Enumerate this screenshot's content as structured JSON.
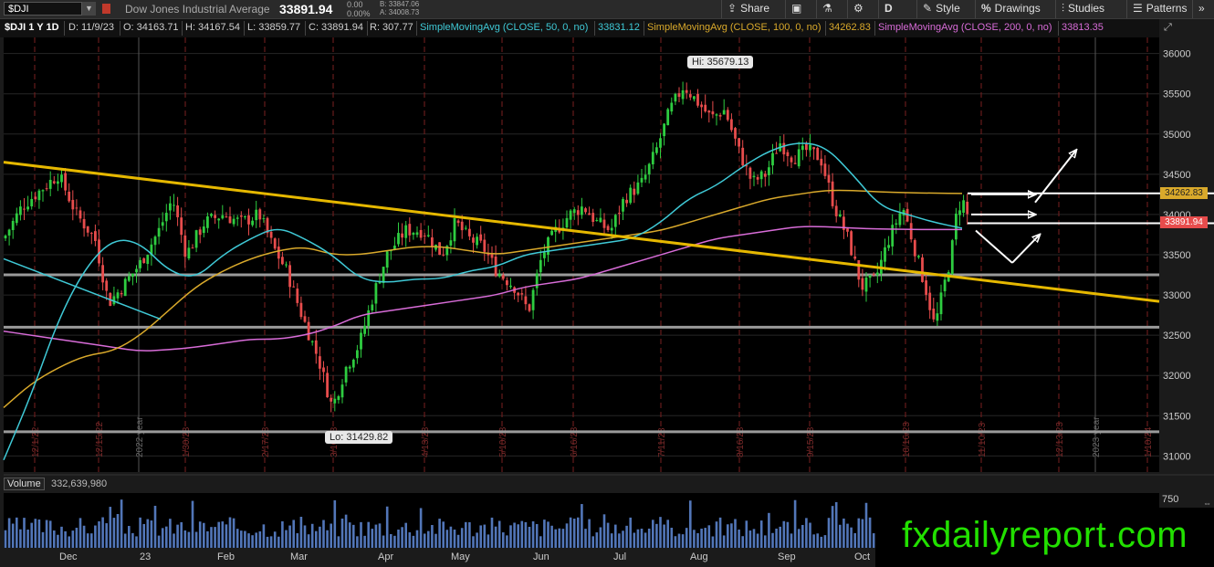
{
  "toolbar": {
    "symbol": "$DJI",
    "description": "Dow Jones Industrial Average",
    "last": "33891.94",
    "change": "0.00",
    "change_pct": "0.00%",
    "bid": "B: 33847.06",
    "ask": "A: 34008.73",
    "share_label": "Share",
    "period_label": "D",
    "style_label": "Style",
    "drawings_label": "Drawings",
    "studies_label": "Studies",
    "patterns_label": "Patterns"
  },
  "infobar": {
    "symbol_period": "$DJI 1 Y 1D",
    "date": "D: 11/9/23",
    "open": "O: 34163.71",
    "high": "H: 34167.54",
    "low": "L: 33859.77",
    "close": "C: 33891.94",
    "range": "R: 307.77",
    "sma50_label": "SimpleMovingAvg (CLOSE, 50, 0, no)",
    "sma50_value": "33831.12",
    "sma100_label": "SimpleMovingAvg (CLOSE, 100, 0, no)",
    "sma100_value": "34262.83",
    "sma200_label": "SimpleMovingAvg (CLOSE, 200, 0, no)",
    "sma200_value": "33813.35"
  },
  "colors": {
    "sma50": "#3fc9d6",
    "sma100": "#d9a92b",
    "sma200": "#d86cd8",
    "up": "#2ecc40",
    "down": "#e74c4c",
    "trendline": "#e6b800",
    "support": "#9a9a9a",
    "arrows": "#ffffff",
    "watermark": "#22e000"
  },
  "volume": {
    "label": "Volume",
    "value": "332,639,980",
    "axis_tick": "750"
  },
  "watermark": "fxdailyreport.com",
  "chart_data": {
    "type": "candlestick",
    "ylim": [
      30800,
      36200
    ],
    "yticks": [
      31000,
      31500,
      32000,
      32500,
      33000,
      33500,
      34000,
      34500,
      35000,
      35500,
      36000
    ],
    "month_labels": [
      "Dec",
      "23",
      "Feb",
      "Mar",
      "Apr",
      "May",
      "Jun",
      "Jul",
      "Aug",
      "Sep",
      "Oct"
    ],
    "date_labels": [
      "12/1/22",
      "12/15/22",
      "2022 year",
      "1/30/23",
      "2/17/23",
      "3/10/23",
      "4/13/23",
      "5/10/23",
      "6/16/23",
      "7/11/23",
      "8/16/23",
      "9/15/23",
      "10/16/23",
      "11/10/23",
      "12/13/23",
      "2023 year",
      "1/10/24"
    ],
    "high_callout": "Hi: 35679.13",
    "low_callout": "Lo: 31429.82",
    "price_marker_100": "34262.83",
    "price_marker_last": "33891.94",
    "support_levels": [
      33250,
      32600,
      31300
    ],
    "trendline": {
      "start": [
        "2022-11-10",
        34650
      ],
      "end": [
        "2024-01-12",
        32920
      ]
    },
    "sma_points": {
      "sma50": [
        [
          0,
          30950
        ],
        [
          30,
          31750
        ],
        [
          60,
          32700
        ],
        [
          90,
          33350
        ],
        [
          120,
          33700
        ],
        [
          150,
          33650
        ],
        [
          180,
          33300
        ],
        [
          210,
          33200
        ],
        [
          240,
          33500
        ],
        [
          270,
          33700
        ],
        [
          300,
          33850
        ],
        [
          330,
          33700
        ],
        [
          360,
          33500
        ],
        [
          390,
          33200
        ],
        [
          420,
          33150
        ],
        [
          450,
          33200
        ],
        [
          480,
          33200
        ],
        [
          510,
          33300
        ],
        [
          540,
          33350
        ],
        [
          570,
          33500
        ],
        [
          600,
          33550
        ],
        [
          630,
          33600
        ],
        [
          660,
          33650
        ],
        [
          690,
          33700
        ],
        [
          720,
          33900
        ],
        [
          750,
          34200
        ],
        [
          780,
          34350
        ],
        [
          810,
          34600
        ],
        [
          840,
          34800
        ],
        [
          870,
          34900
        ],
        [
          900,
          34850
        ],
        [
          930,
          34500
        ],
        [
          960,
          34100
        ],
        [
          990,
          34000
        ],
        [
          1020,
          33900
        ],
        [
          1050,
          33830
        ]
      ],
      "sma100": [
        [
          0,
          31600
        ],
        [
          30,
          31900
        ],
        [
          60,
          32100
        ],
        [
          90,
          32250
        ],
        [
          120,
          32300
        ],
        [
          150,
          32500
        ],
        [
          180,
          32800
        ],
        [
          210,
          33100
        ],
        [
          240,
          33300
        ],
        [
          270,
          33450
        ],
        [
          300,
          33550
        ],
        [
          330,
          33600
        ],
        [
          360,
          33500
        ],
        [
          390,
          33500
        ],
        [
          420,
          33550
        ],
        [
          450,
          33600
        ],
        [
          480,
          33600
        ],
        [
          510,
          33550
        ],
        [
          540,
          33500
        ],
        [
          570,
          33550
        ],
        [
          600,
          33600
        ],
        [
          630,
          33650
        ],
        [
          660,
          33700
        ],
        [
          690,
          33750
        ],
        [
          720,
          33800
        ],
        [
          750,
          33900
        ],
        [
          780,
          34000
        ],
        [
          810,
          34100
        ],
        [
          840,
          34200
        ],
        [
          870,
          34250
        ],
        [
          900,
          34300
        ],
        [
          930,
          34300
        ],
        [
          960,
          34280
        ],
        [
          990,
          34270
        ],
        [
          1020,
          34265
        ],
        [
          1050,
          34262
        ]
      ],
      "sma200": [
        [
          0,
          32550
        ],
        [
          30,
          32500
        ],
        [
          60,
          32450
        ],
        [
          90,
          32400
        ],
        [
          120,
          32350
        ],
        [
          150,
          32300
        ],
        [
          180,
          32320
        ],
        [
          210,
          32350
        ],
        [
          240,
          32400
        ],
        [
          270,
          32450
        ],
        [
          300,
          32450
        ],
        [
          330,
          32500
        ],
        [
          360,
          32600
        ],
        [
          390,
          32750
        ],
        [
          420,
          32800
        ],
        [
          450,
          32850
        ],
        [
          480,
          32900
        ],
        [
          510,
          32950
        ],
        [
          540,
          33000
        ],
        [
          570,
          33100
        ],
        [
          600,
          33150
        ],
        [
          630,
          33200
        ],
        [
          660,
          33300
        ],
        [
          690,
          33400
        ],
        [
          720,
          33500
        ],
        [
          750,
          33600
        ],
        [
          780,
          33700
        ],
        [
          810,
          33750
        ],
        [
          840,
          33800
        ],
        [
          870,
          33850
        ],
        [
          900,
          33850
        ],
        [
          930,
          33830
        ],
        [
          960,
          33820
        ],
        [
          990,
          33815
        ],
        [
          1020,
          33813
        ],
        [
          1050,
          33813
        ]
      ]
    },
    "close_path": [
      [
        0,
        33700
      ],
      [
        20,
        34100
      ],
      [
        40,
        34300
      ],
      [
        60,
        34500
      ],
      [
        80,
        34000
      ],
      [
        100,
        33700
      ],
      [
        115,
        32900
      ],
      [
        130,
        33100
      ],
      [
        150,
        33400
      ],
      [
        170,
        33800
      ],
      [
        185,
        34200
      ],
      [
        200,
        33500
      ],
      [
        220,
        33900
      ],
      [
        240,
        34000
      ],
      [
        260,
        33900
      ],
      [
        280,
        34000
      ],
      [
        295,
        33600
      ],
      [
        310,
        33300
      ],
      [
        325,
        32800
      ],
      [
        345,
        32200
      ],
      [
        360,
        31600
      ],
      [
        375,
        32100
      ],
      [
        390,
        32400
      ],
      [
        405,
        33000
      ],
      [
        420,
        33500
      ],
      [
        440,
        33800
      ],
      [
        460,
        33800
      ],
      [
        480,
        33500
      ],
      [
        495,
        33900
      ],
      [
        510,
        33700
      ],
      [
        525,
        33600
      ],
      [
        540,
        33300
      ],
      [
        560,
        33100
      ],
      [
        575,
        32800
      ],
      [
        590,
        33500
      ],
      [
        605,
        33800
      ],
      [
        620,
        34000
      ],
      [
        635,
        34100
      ],
      [
        650,
        33900
      ],
      [
        665,
        33800
      ],
      [
        680,
        34200
      ],
      [
        700,
        34400
      ],
      [
        715,
        34800
      ],
      [
        730,
        35300
      ],
      [
        745,
        35600
      ],
      [
        760,
        35400
      ],
      [
        775,
        35200
      ],
      [
        790,
        35300
      ],
      [
        805,
        34800
      ],
      [
        820,
        34400
      ],
      [
        835,
        34500
      ],
      [
        850,
        34900
      ],
      [
        865,
        34700
      ],
      [
        880,
        34800
      ],
      [
        895,
        34700
      ],
      [
        910,
        34100
      ],
      [
        925,
        33700
      ],
      [
        940,
        33100
      ],
      [
        955,
        33200
      ],
      [
        970,
        33700
      ],
      [
        985,
        34100
      ],
      [
        1000,
        33500
      ],
      [
        1012,
        33000
      ],
      [
        1020,
        32600
      ],
      [
        1030,
        33100
      ],
      [
        1038,
        33500
      ],
      [
        1045,
        34100
      ],
      [
        1052,
        34150
      ],
      [
        1058,
        33892
      ]
    ],
    "projection_arrows": [
      {
        "from": [
          1060,
          34250
        ],
        "to": [
          1130,
          34250
        ]
      },
      {
        "from": [
          1060,
          34000
        ],
        "to": [
          1130,
          34000
        ]
      },
      {
        "from": [
          1130,
          34150
        ],
        "to": [
          1175,
          34800
        ]
      },
      {
        "from": [
          1065,
          33800
        ],
        "to": [
          1105,
          33400
        ]
      },
      {
        "from": [
          1105,
          33400
        ],
        "to": [
          1135,
          33750
        ]
      }
    ]
  }
}
